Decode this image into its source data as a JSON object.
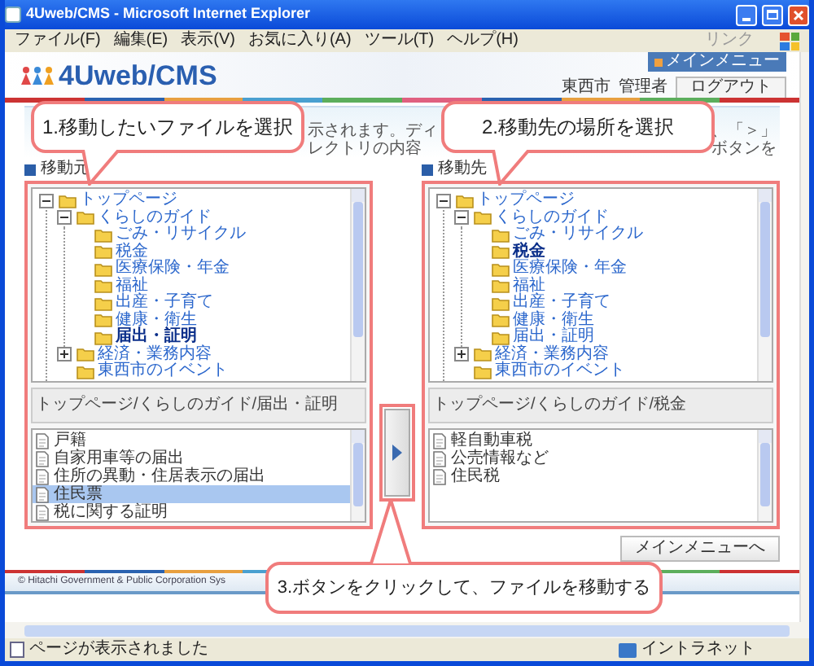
{
  "window": {
    "title": "4Uweb/CMS - Microsoft Internet Explorer"
  },
  "menu_bar": [
    "ファイル(F)",
    "編集(E)",
    "表示(V)",
    "お気に入り(A)",
    "ツール(T)",
    "ヘルプ(H)"
  ],
  "links_label": "リンク",
  "header": {
    "logo": "4Uweb/CMS",
    "main_menu_tab": "メインメニュー",
    "organization": "東西市",
    "user": "管理者",
    "logout_button": "ログアウト"
  },
  "instruction_fragments": [
    "示されます。ディレクトリの内容",
    "、「＞」ボタンを"
  ],
  "source": {
    "label": "移動元",
    "tree": [
      {
        "name": "トップページ",
        "selected": false,
        "expanded": true,
        "children": [
          {
            "name": "くらしのガイド",
            "selected": false,
            "expanded": true,
            "children": [
              {
                "name": "ごみ・リサイクル",
                "selected": false
              },
              {
                "name": "税金",
                "selected": false
              },
              {
                "name": "医療保険・年金",
                "selected": false
              },
              {
                "name": "福祉",
                "selected": false
              },
              {
                "name": "出産・子育て",
                "selected": false
              },
              {
                "name": "健康・衛生",
                "selected": false
              },
              {
                "name": "届出・証明",
                "selected": true
              }
            ]
          },
          {
            "name": "経済・業務内容",
            "selected": false,
            "expanded": false
          },
          {
            "name": "東西市のイベント",
            "selected": false
          }
        ]
      }
    ],
    "path": "トップページ/くらしのガイド/届出・証明",
    "files": [
      {
        "name": "戸籍",
        "selected": false
      },
      {
        "name": "自家用車等の届出",
        "selected": false
      },
      {
        "name": "住所の異動・住居表示の届出",
        "selected": false
      },
      {
        "name": "住民票",
        "selected": true
      },
      {
        "name": "税に関する証明",
        "selected": false
      }
    ]
  },
  "destination": {
    "label": "移動先",
    "tree": [
      {
        "name": "トップページ",
        "selected": false,
        "expanded": true,
        "children": [
          {
            "name": "くらしのガイド",
            "selected": false,
            "expanded": true,
            "children": [
              {
                "name": "ごみ・リサイクル",
                "selected": false
              },
              {
                "name": "税金",
                "selected": true
              },
              {
                "name": "医療保険・年金",
                "selected": false
              },
              {
                "name": "福祉",
                "selected": false
              },
              {
                "name": "出産・子育て",
                "selected": false
              },
              {
                "name": "健康・衛生",
                "selected": false
              },
              {
                "name": "届出・証明",
                "selected": false
              }
            ]
          },
          {
            "name": "経済・業務内容",
            "selected": false,
            "expanded": false
          },
          {
            "name": "東西市のイベント",
            "selected": false
          }
        ]
      }
    ],
    "path": "トップページ/くらしのガイド/税金",
    "files": [
      {
        "name": "軽自動車税",
        "selected": false
      },
      {
        "name": "公売情報など",
        "selected": false
      },
      {
        "name": "住民税",
        "selected": false
      }
    ]
  },
  "main_menu_button": "メインメニューへ",
  "footer": "© Hitachi Government & Public Corporation Sys",
  "callouts": [
    "1.移動したいファイルを選択",
    "2.移動先の場所を選択",
    "3.ボタンをクリックして、ファイルを移動する"
  ],
  "status_bar": {
    "message": "ページが表示されました",
    "zone": "イントラネット"
  }
}
